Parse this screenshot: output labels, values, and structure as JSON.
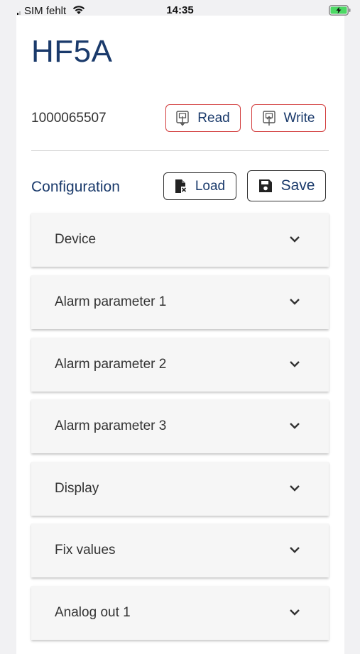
{
  "status_bar": {
    "carrier": "SIM fehlt",
    "time": "14:35",
    "icons": [
      "signal-icon",
      "wifi-icon",
      "battery-charging-icon"
    ]
  },
  "header": {
    "title": "HF5A"
  },
  "device": {
    "serial": "1000065507",
    "read_label": "Read",
    "write_label": "Write"
  },
  "configuration": {
    "title": "Configuration",
    "load_label": "Load",
    "save_label": "Save"
  },
  "accordion": [
    {
      "label": "Device"
    },
    {
      "label": "Alarm parameter 1"
    },
    {
      "label": "Alarm parameter 2"
    },
    {
      "label": "Alarm parameter 3"
    },
    {
      "label": "Display"
    },
    {
      "label": "Fix values"
    },
    {
      "label": "Analog out 1"
    }
  ],
  "colors": {
    "accent": "#1a3a6b",
    "button_border_red": "#d23b3b",
    "background": "#f1f1f3"
  }
}
